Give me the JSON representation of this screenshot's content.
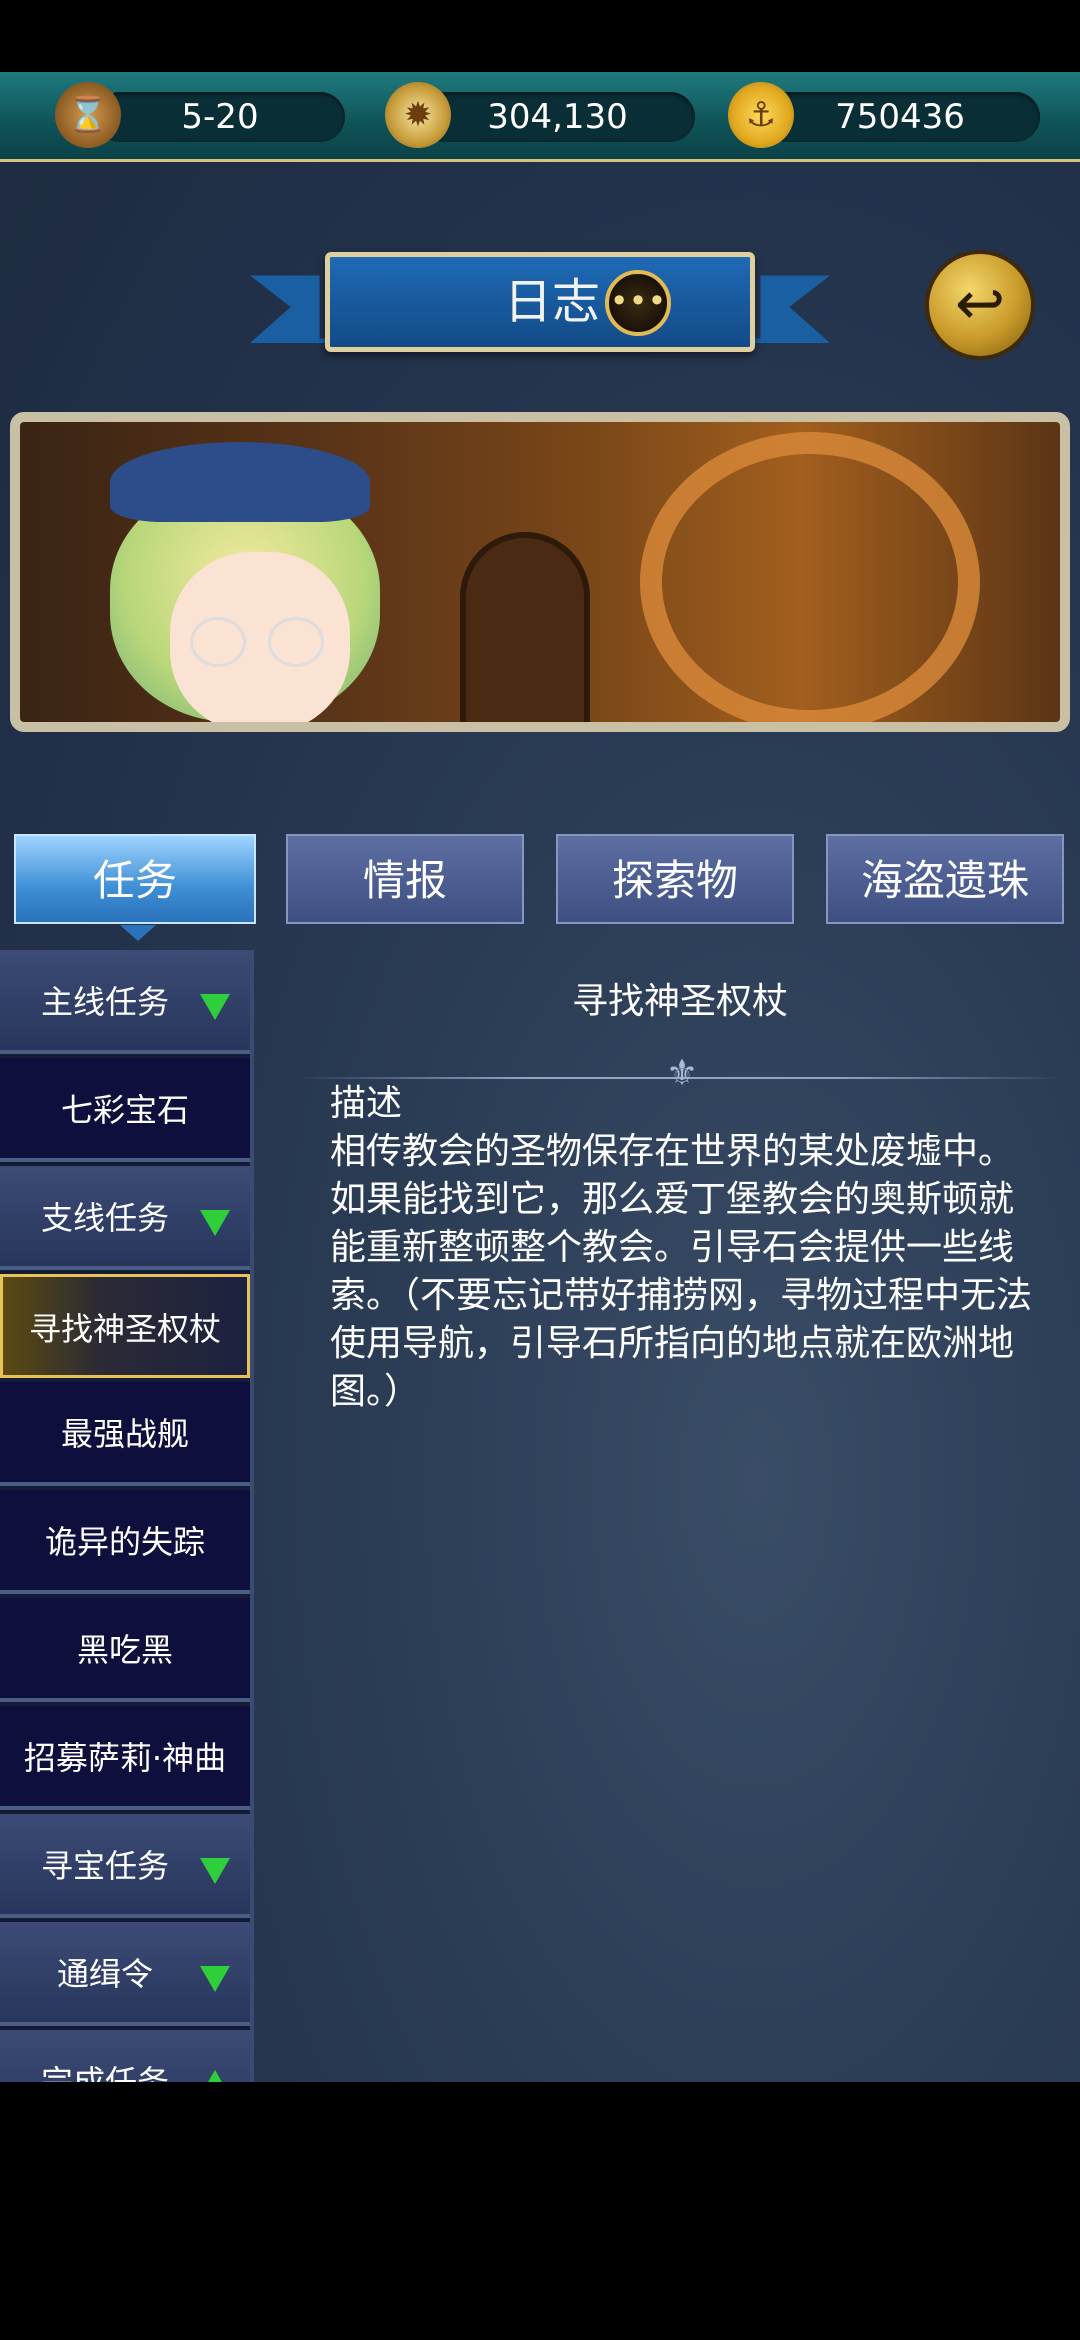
{
  "resources": {
    "time": "5-20",
    "compass": "304,130",
    "gold": "750436"
  },
  "header": {
    "title": "日志"
  },
  "tabs": [
    "任务",
    "情报",
    "探索物",
    "海盗遗珠"
  ],
  "sidebar": {
    "items": [
      {
        "label": "主线任务",
        "type": "category",
        "arrow": "down"
      },
      {
        "label": "七彩宝石",
        "type": "quest"
      },
      {
        "label": "支线任务",
        "type": "category",
        "arrow": "down"
      },
      {
        "label": "寻找神圣权杖",
        "type": "quest",
        "selected": true
      },
      {
        "label": "最强战舰",
        "type": "quest"
      },
      {
        "label": "诡异的失踪",
        "type": "quest"
      },
      {
        "label": "黑吃黑",
        "type": "quest"
      },
      {
        "label": "招募萨莉·神曲",
        "type": "quest"
      },
      {
        "label": "寻宝任务",
        "type": "category",
        "arrow": "down"
      },
      {
        "label": "通缉令",
        "type": "category",
        "arrow": "down"
      },
      {
        "label": "完成任务",
        "type": "category",
        "arrow": "up"
      }
    ]
  },
  "quest": {
    "title": "寻找神圣权杖",
    "heading": "描述",
    "description": "相传教会的圣物保存在世界的某处废墟中。如果能找到它，那么爱丁堡教会的奥斯顿就能重新整顿整个教会。引导石会提供一些线索。（不要忘记带好捕捞网，寻物过程中无法使用导航，引导石所指向的地点就在欧洲地图。）"
  },
  "colors": {
    "accent": "#e8c35a",
    "arrow": "#2ecf3a",
    "tab_active": "#3f8fd5"
  }
}
